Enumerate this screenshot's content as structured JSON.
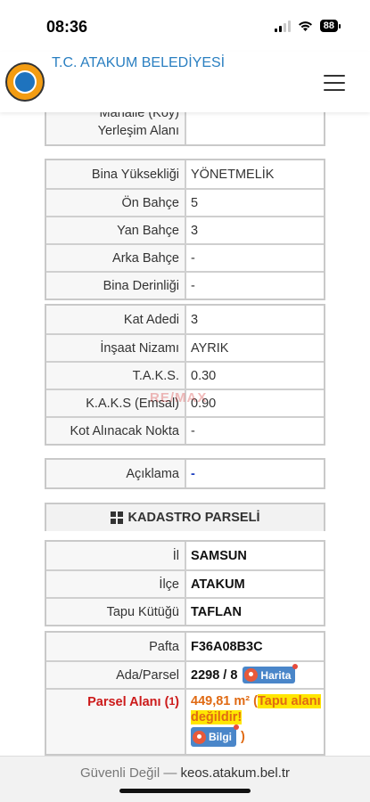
{
  "status": {
    "time": "08:36",
    "battery": "88"
  },
  "header": {
    "title": "T.C. ATAKUM BELEDİYESİ"
  },
  "table_top": {
    "label_partial": "Mahalle (Köy)",
    "label": "Yerleşim Alanı",
    "value": ""
  },
  "table_building": [
    {
      "label": "Bina Yüksekliği",
      "value": "YÖNETMELİK"
    },
    {
      "label": "Ön Bahçe",
      "value": "5"
    },
    {
      "label": "Yan Bahçe",
      "value": "3"
    },
    {
      "label": "Arka Bahçe",
      "value": "-"
    },
    {
      "label": "Bina Derinliği",
      "value": "-"
    }
  ],
  "table_floor": [
    {
      "label": "Kat Adedi",
      "value": "3"
    },
    {
      "label": "İnşaat Nizamı",
      "value": "AYRIK"
    },
    {
      "label": "T.A.K.S.",
      "value": "0.30"
    },
    {
      "label": "K.A.K.S (Emsal)",
      "value": "0.90"
    },
    {
      "label": "Kot Alınacak Nokta",
      "value": "-"
    }
  ],
  "table_desc": {
    "label": "Açıklama",
    "value": "-"
  },
  "watermark": "RE/MAX",
  "kadastro": {
    "title": "KADASTRO PARSELİ",
    "rows": [
      {
        "label": "İl",
        "value": "SAMSUN"
      },
      {
        "label": "İlçe",
        "value": "ATAKUM"
      },
      {
        "label": "Tapu Kütüğü",
        "value": "TAFLAN"
      }
    ],
    "pafta_label": "Pafta",
    "pafta_value": "F36A08B3C",
    "ada_label": "Ada/Parsel",
    "ada_value": "2298 / 8",
    "harita_label": "Harita",
    "parsel_label": "Parsel Alanı (",
    "parsel_sup": "1",
    "parsel_label_end": ")",
    "parsel_value": "449,81 m² (",
    "parsel_note": "Tapu alanı değildir!",
    "bilgi_label": "Bilgi",
    "close_paren": ")"
  },
  "urlbar": {
    "prefix": "Güvenli Değil — ",
    "domain": "keos.atakum.bel.tr"
  }
}
